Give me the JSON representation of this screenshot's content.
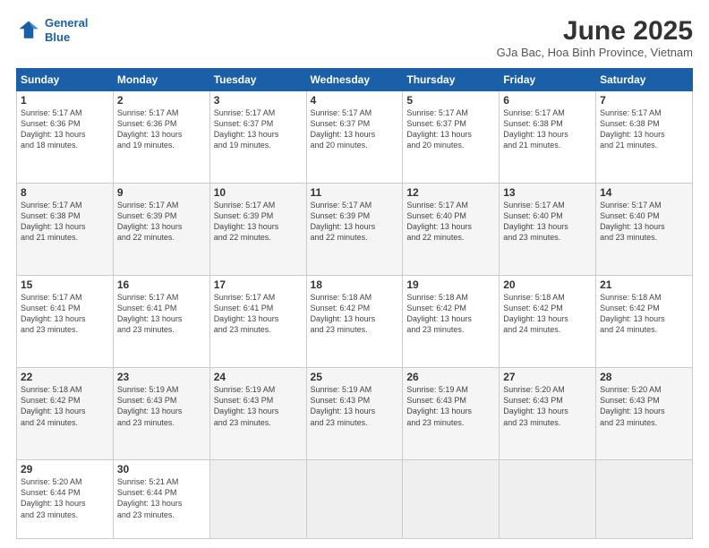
{
  "header": {
    "logo_line1": "General",
    "logo_line2": "Blue",
    "title": "June 2025",
    "subtitle": "GJa Bac, Hoa Binh Province, Vietnam"
  },
  "days_of_week": [
    "Sunday",
    "Monday",
    "Tuesday",
    "Wednesday",
    "Thursday",
    "Friday",
    "Saturday"
  ],
  "weeks": [
    [
      {
        "day": "1",
        "info": "Sunrise: 5:17 AM\nSunset: 6:36 PM\nDaylight: 13 hours\nand 18 minutes."
      },
      {
        "day": "2",
        "info": "Sunrise: 5:17 AM\nSunset: 6:36 PM\nDaylight: 13 hours\nand 19 minutes."
      },
      {
        "day": "3",
        "info": "Sunrise: 5:17 AM\nSunset: 6:37 PM\nDaylight: 13 hours\nand 19 minutes."
      },
      {
        "day": "4",
        "info": "Sunrise: 5:17 AM\nSunset: 6:37 PM\nDaylight: 13 hours\nand 20 minutes."
      },
      {
        "day": "5",
        "info": "Sunrise: 5:17 AM\nSunset: 6:37 PM\nDaylight: 13 hours\nand 20 minutes."
      },
      {
        "day": "6",
        "info": "Sunrise: 5:17 AM\nSunset: 6:38 PM\nDaylight: 13 hours\nand 21 minutes."
      },
      {
        "day": "7",
        "info": "Sunrise: 5:17 AM\nSunset: 6:38 PM\nDaylight: 13 hours\nand 21 minutes."
      }
    ],
    [
      {
        "day": "8",
        "info": "Sunrise: 5:17 AM\nSunset: 6:38 PM\nDaylight: 13 hours\nand 21 minutes."
      },
      {
        "day": "9",
        "info": "Sunrise: 5:17 AM\nSunset: 6:39 PM\nDaylight: 13 hours\nand 22 minutes."
      },
      {
        "day": "10",
        "info": "Sunrise: 5:17 AM\nSunset: 6:39 PM\nDaylight: 13 hours\nand 22 minutes."
      },
      {
        "day": "11",
        "info": "Sunrise: 5:17 AM\nSunset: 6:39 PM\nDaylight: 13 hours\nand 22 minutes."
      },
      {
        "day": "12",
        "info": "Sunrise: 5:17 AM\nSunset: 6:40 PM\nDaylight: 13 hours\nand 22 minutes."
      },
      {
        "day": "13",
        "info": "Sunrise: 5:17 AM\nSunset: 6:40 PM\nDaylight: 13 hours\nand 23 minutes."
      },
      {
        "day": "14",
        "info": "Sunrise: 5:17 AM\nSunset: 6:40 PM\nDaylight: 13 hours\nand 23 minutes."
      }
    ],
    [
      {
        "day": "15",
        "info": "Sunrise: 5:17 AM\nSunset: 6:41 PM\nDaylight: 13 hours\nand 23 minutes."
      },
      {
        "day": "16",
        "info": "Sunrise: 5:17 AM\nSunset: 6:41 PM\nDaylight: 13 hours\nand 23 minutes."
      },
      {
        "day": "17",
        "info": "Sunrise: 5:17 AM\nSunset: 6:41 PM\nDaylight: 13 hours\nand 23 minutes."
      },
      {
        "day": "18",
        "info": "Sunrise: 5:18 AM\nSunset: 6:42 PM\nDaylight: 13 hours\nand 23 minutes."
      },
      {
        "day": "19",
        "info": "Sunrise: 5:18 AM\nSunset: 6:42 PM\nDaylight: 13 hours\nand 23 minutes."
      },
      {
        "day": "20",
        "info": "Sunrise: 5:18 AM\nSunset: 6:42 PM\nDaylight: 13 hours\nand 24 minutes."
      },
      {
        "day": "21",
        "info": "Sunrise: 5:18 AM\nSunset: 6:42 PM\nDaylight: 13 hours\nand 24 minutes."
      }
    ],
    [
      {
        "day": "22",
        "info": "Sunrise: 5:18 AM\nSunset: 6:42 PM\nDaylight: 13 hours\nand 24 minutes."
      },
      {
        "day": "23",
        "info": "Sunrise: 5:19 AM\nSunset: 6:43 PM\nDaylight: 13 hours\nand 23 minutes."
      },
      {
        "day": "24",
        "info": "Sunrise: 5:19 AM\nSunset: 6:43 PM\nDaylight: 13 hours\nand 23 minutes."
      },
      {
        "day": "25",
        "info": "Sunrise: 5:19 AM\nSunset: 6:43 PM\nDaylight: 13 hours\nand 23 minutes."
      },
      {
        "day": "26",
        "info": "Sunrise: 5:19 AM\nSunset: 6:43 PM\nDaylight: 13 hours\nand 23 minutes."
      },
      {
        "day": "27",
        "info": "Sunrise: 5:20 AM\nSunset: 6:43 PM\nDaylight: 13 hours\nand 23 minutes."
      },
      {
        "day": "28",
        "info": "Sunrise: 5:20 AM\nSunset: 6:43 PM\nDaylight: 13 hours\nand 23 minutes."
      }
    ],
    [
      {
        "day": "29",
        "info": "Sunrise: 5:20 AM\nSunset: 6:44 PM\nDaylight: 13 hours\nand 23 minutes."
      },
      {
        "day": "30",
        "info": "Sunrise: 5:21 AM\nSunset: 6:44 PM\nDaylight: 13 hours\nand 23 minutes."
      },
      {
        "day": "",
        "info": ""
      },
      {
        "day": "",
        "info": ""
      },
      {
        "day": "",
        "info": ""
      },
      {
        "day": "",
        "info": ""
      },
      {
        "day": "",
        "info": ""
      }
    ]
  ]
}
